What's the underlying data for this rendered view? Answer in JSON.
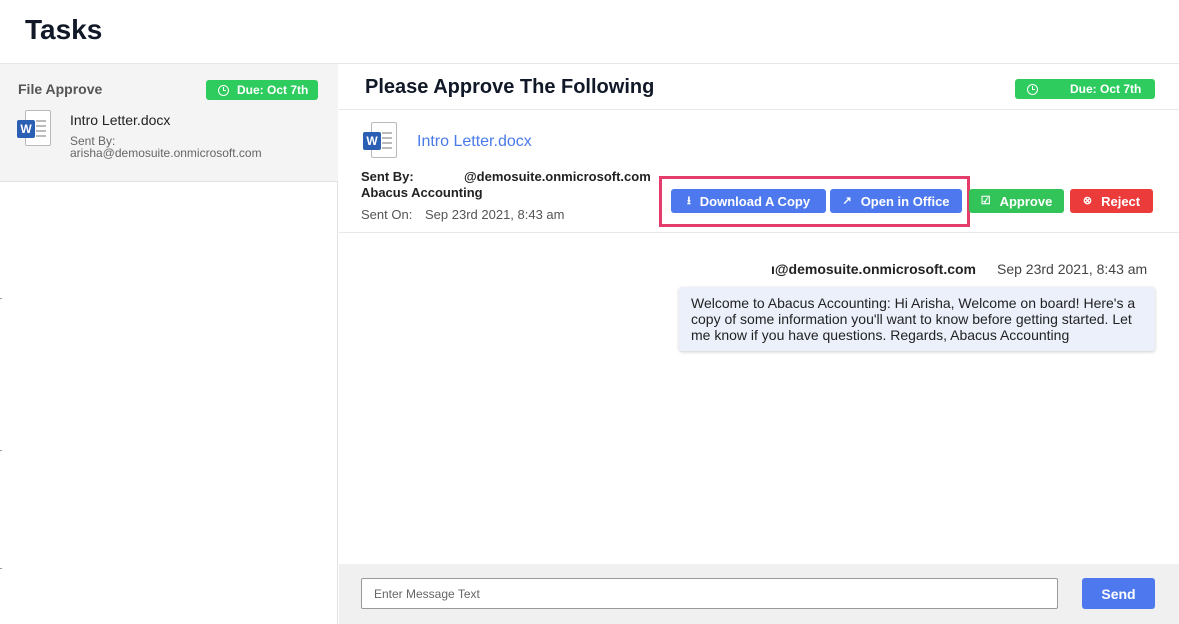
{
  "page": {
    "title": "Tasks"
  },
  "task_list": {
    "items": [
      {
        "type": "File Approve",
        "due": "Due: Oct 7th",
        "file_name": "Intro Letter.docx",
        "sent_by_label": "Sent By:",
        "sent_by_email": "arisha@demosuite.onmicrosoft.com",
        "file_icon": "word-doc-icon"
      }
    ]
  },
  "detail": {
    "title": "Please Approve The Following",
    "due": "Due: Oct 7th",
    "file_name": "Intro Letter.docx",
    "file_icon": "word-doc-icon",
    "sent_by_label": "Sent By:",
    "sent_by_email": "@demosuite.onmicrosoft.com",
    "sent_by_org": "Abacus Accounting",
    "sent_on_label": "Sent On:",
    "sent_on_value": "Sep 23rd 2021, 8:43 am",
    "actions": {
      "download": "Download A Copy",
      "open_in_office": "Open in Office",
      "approve": "Approve",
      "reject": "Reject"
    },
    "message": {
      "sender": "ı@demosuite.onmicrosoft.com",
      "time": "Sep 23rd 2021, 8:43 am",
      "text": "Welcome to Abacus Accounting: Hi Arisha, Welcome on board! Here's a copy of some information you'll want to know before getting started. Let me know if you have questions. Regards, Abacus Accounting"
    },
    "composer": {
      "placeholder": "Enter Message Text",
      "send_label": "Send"
    }
  },
  "colors": {
    "due_badge": "#2ecc5f",
    "primary_button": "#4e79ee",
    "approve_button": "#33c459",
    "reject_button": "#ec3b3b",
    "highlight": "#e53d6b",
    "link": "#4a7ae8"
  }
}
